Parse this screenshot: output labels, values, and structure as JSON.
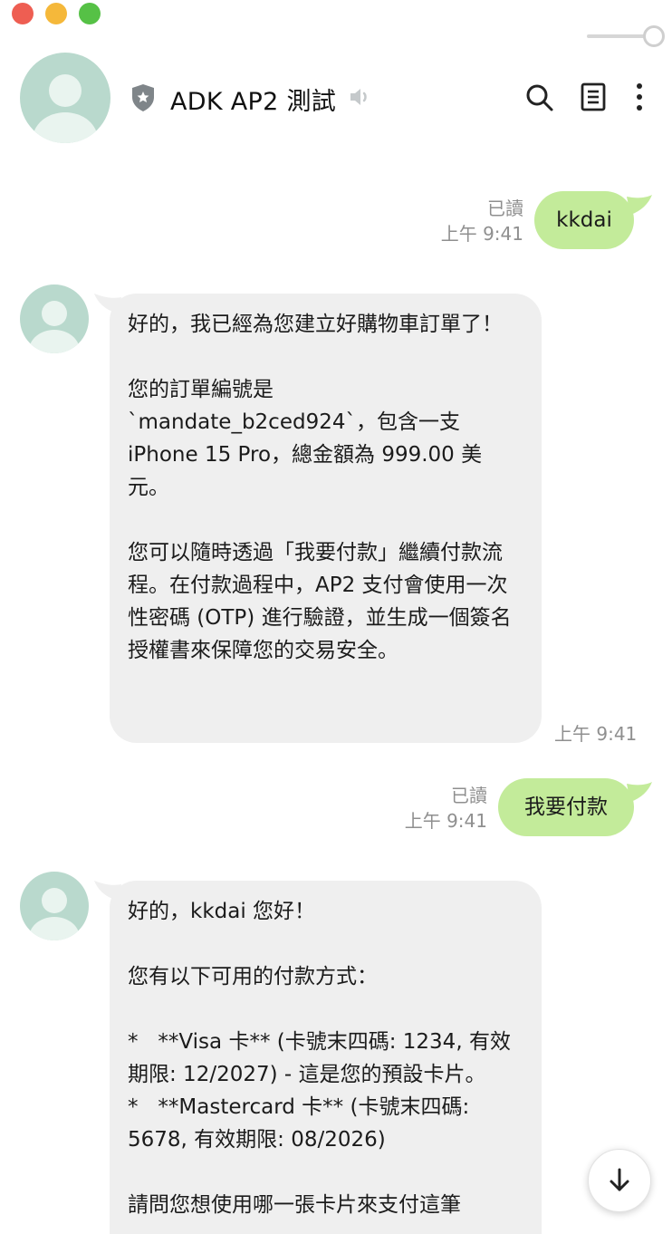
{
  "window": {
    "controls": [
      "close",
      "minimize",
      "maximize"
    ]
  },
  "header": {
    "title": "ADK AP2 測試",
    "icons": [
      "shield-star-icon",
      "speaker-icon",
      "search-icon",
      "notes-icon",
      "more-vertical-icon"
    ]
  },
  "messages": [
    {
      "side": "right",
      "text": "kkdai",
      "read": "已讀",
      "time": "上午 9:41"
    },
    {
      "side": "left",
      "paragraphs": [
        "好的，我已經為您建立好購物車訂單了！",
        "您的訂單編號是 `mandate_b2ced924`，包含一支 iPhone 15 Pro，總金額為 999.00 美元。",
        "您可以隨時透過「我要付款」繼續付款流程。在付款過程中，AP2 支付會使用一次性密碼 (OTP) 進行驗證，並生成一個簽名授權書來保障您的交易安全。"
      ],
      "time": "上午 9:41"
    },
    {
      "side": "right",
      "text": "我要付款",
      "read": "已讀",
      "time": "上午 9:41"
    },
    {
      "side": "left",
      "paragraphs": [
        "好的，kkdai 您好！",
        "您有以下可用的付款方式：",
        "*   **Visa 卡** (卡號末四碼: 1234, 有效期限: 12/2027) - 這是您的預設卡片。\n*   **Mastercard 卡** (卡號末四碼: 5678, 有效期限: 08/2026)",
        "請問您想使用哪一張卡片來支付這筆"
      ]
    }
  ],
  "colors": {
    "sent_bubble": "#c3eb9a",
    "received_bubble": "#efefef",
    "avatar_bg": "#b9d9cd",
    "meta_text": "#8f8f8f"
  }
}
